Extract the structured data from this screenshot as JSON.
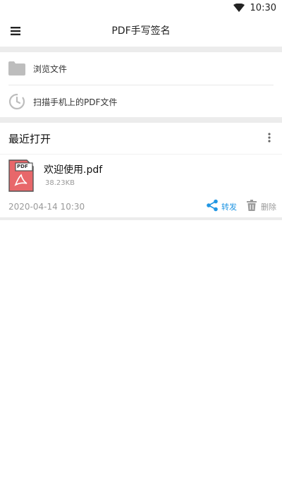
{
  "status_bar": {
    "time": "10:30",
    "icons": [
      "wifi-icon"
    ]
  },
  "app_bar": {
    "title": "PDF手写签名",
    "menu_icon": "menu-icon"
  },
  "actions": [
    {
      "label": "浏览文件",
      "icon": "folder-icon"
    },
    {
      "label": "扫描手机上的PDF文件",
      "icon": "scan-clock-icon"
    }
  ],
  "recent": {
    "title": "最近打开",
    "more_icon": "more-vertical-icon",
    "files": [
      {
        "name": "欢迎使用.pdf",
        "size": "38.23KB",
        "date": "2020-04-14 10:30",
        "badge": "PDF",
        "share_label": "转发",
        "delete_label": "删除"
      }
    ]
  },
  "colors": {
    "accent": "#2196e3",
    "pdf_red": "#e8676a",
    "muted": "#9a9a9a",
    "background": "#ececec"
  }
}
